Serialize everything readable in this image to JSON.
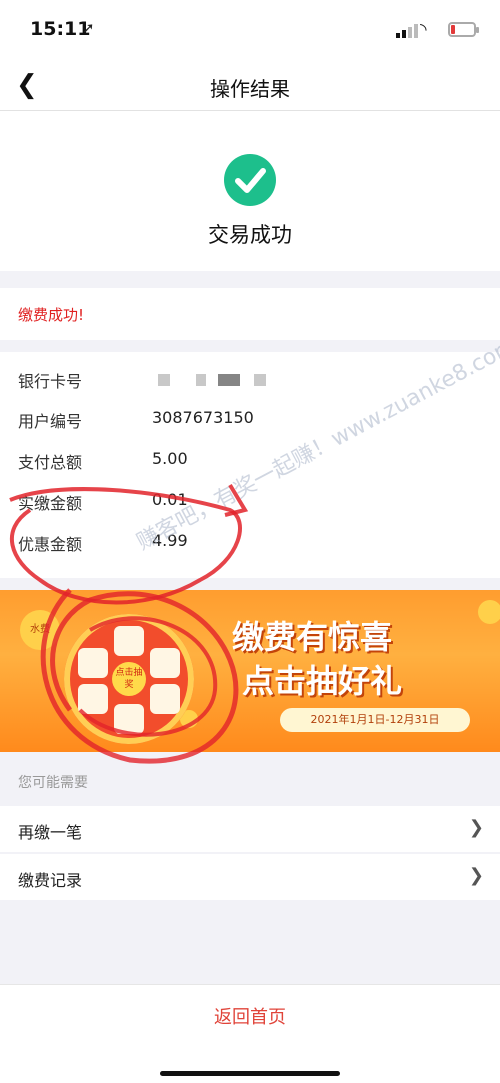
{
  "status_bar": {
    "time": "15:11",
    "location_icon": "location-arrow-icon",
    "signal_icon": "signal-icon",
    "wifi_icon": "wifi-icon",
    "battery_icon": "battery-icon"
  },
  "nav": {
    "back_icon": "chevron-left-icon",
    "title": "操作结果"
  },
  "result": {
    "icon": "check-circle-icon",
    "status_text": "交易成功",
    "accent": "#1dbf8c"
  },
  "message": {
    "text": "缴费成功!",
    "color": "#e02020"
  },
  "details": [
    {
      "label": "银行卡号",
      "value": ""
    },
    {
      "label": "用户编号",
      "value": "3087673150"
    },
    {
      "label": "支付总额",
      "value": "5.00"
    },
    {
      "label": "实缴金额",
      "value": "0.01"
    },
    {
      "label": "优惠金额",
      "value": "4.99"
    }
  ],
  "banner": {
    "title_line1": "缴费有惊喜",
    "title_line2": "点击抽好礼",
    "date": "2021年1月1日-12月31日",
    "wheel_center": "点击抽奖",
    "corner_tag": "水费"
  },
  "watermark": "赚客吧，有奖一起赚！www.zuanke8.com",
  "suggest": {
    "section_title": "您可能需要",
    "items": [
      {
        "label": "再缴一笔",
        "icon": "chevron-right-icon"
      },
      {
        "label": "缴费记录",
        "icon": "chevron-right-icon"
      }
    ]
  },
  "footer": {
    "home_label": "返回首页",
    "color": "#e0443a"
  }
}
